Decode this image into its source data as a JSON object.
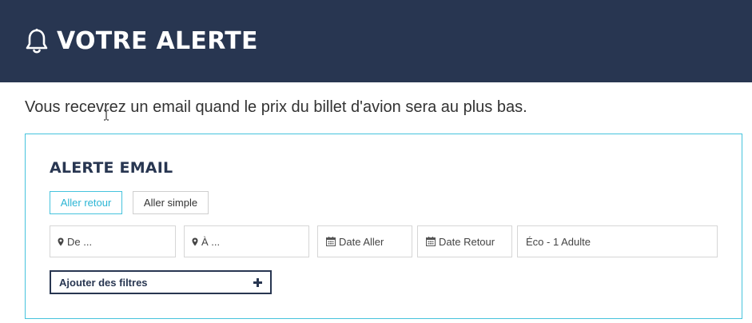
{
  "header": {
    "title": "VOTRE ALERTE",
    "icon": "bell-icon",
    "background": "#283651"
  },
  "subtitle": "Vous recevrez un email quand le prix du billet d'avion sera au plus bas.",
  "panel": {
    "title": "ALERTE EMAIL",
    "border_color": "#46c3dd",
    "trip_types": {
      "round_trip": "Aller retour",
      "one_way": "Aller simple",
      "selected": "Aller retour"
    },
    "fields": {
      "from": {
        "placeholder": "De ...",
        "icon": "map-marker-icon"
      },
      "to": {
        "placeholder": "À ...",
        "icon": "map-marker-icon"
      },
      "departure_date": {
        "placeholder": "Date Aller",
        "icon": "calendar-icon"
      },
      "return_date": {
        "placeholder": "Date Retour",
        "icon": "calendar-icon"
      },
      "class_passengers": {
        "value": "Éco - 1 Adulte"
      }
    },
    "add_filters": {
      "label": "Ajouter des filtres",
      "icon": "plus-icon"
    }
  }
}
